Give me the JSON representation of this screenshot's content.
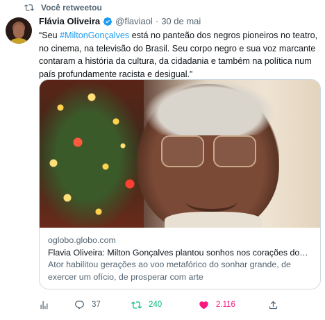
{
  "retweet_header": {
    "label": "Você retweetou"
  },
  "author": {
    "name": "Flávia Oliveira",
    "handle": "@flaviaol",
    "separator": "·",
    "date": "30 de mai"
  },
  "tweet": {
    "text_before": "“Seu ",
    "hashtag": "#MiltonGonçalves",
    "text_after": " está no panteão dos negros pioneiros no teatro, no cinema, na televisão do Brasil. Seu corpo negro e sua voz marcante contaram a história da cultura, da cidadania e também na política num país profundamente racista e desigual.”"
  },
  "card": {
    "domain": "oglobo.globo.com",
    "title": "Flavia Oliveira: Milton Gonçalves plantou sonhos nos corações dos br...",
    "description": "Ator habilitou gerações ao voo metafórico do sonhar grande, de exercer um ofício, de prosperar com arte"
  },
  "actions": {
    "views_icon": "analytics-icon",
    "reply_count": "37",
    "retweet_count": "240",
    "like_count": "2.116",
    "share_icon": "share-icon"
  },
  "colors": {
    "accent": "#1d9bf0",
    "retweet_active": "#00ba7c",
    "like_active": "#f91880",
    "muted": "#536471"
  }
}
